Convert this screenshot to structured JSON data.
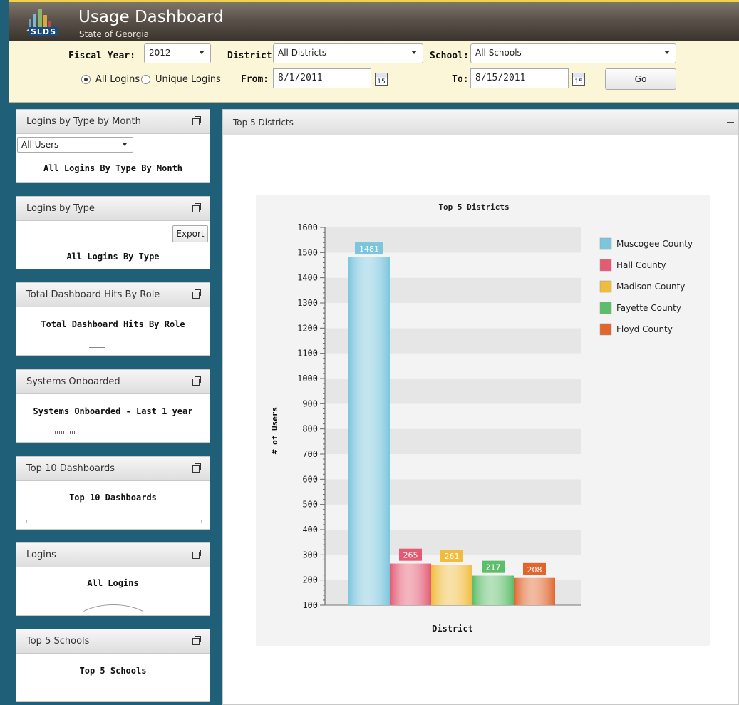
{
  "app": {
    "title": "Usage Dashboard",
    "subtitle": "State of Georgia",
    "logo_text": "SLDS"
  },
  "filters": {
    "fiscal_year_label": "Fiscal Year:",
    "fiscal_year_value": "2012",
    "district_label": "District:",
    "district_value": "All Districts",
    "school_label": "School:",
    "school_value": "All Schools",
    "radio_all_label": "All Logins",
    "radio_unique_label": "Unique Logins",
    "selected_radio": "All Logins",
    "from_label": "From:",
    "from_value": "8/1/2011",
    "to_label": "To:",
    "to_value": "8/15/2011",
    "calendar_day": "15",
    "go_label": "Go"
  },
  "widgets": [
    {
      "title": "Logins by Type by Month",
      "body_title": "All Logins By Type By Month",
      "dropdown": "All Users"
    },
    {
      "title": "Logins by Type",
      "body_title": "All Logins By Type",
      "button": "Export"
    },
    {
      "title": "Total Dashboard Hits By Role",
      "body_title": "Total Dashboard Hits By Role"
    },
    {
      "title": "Systems Onboarded",
      "body_title": "Systems Onboarded - Last 1 year"
    },
    {
      "title": "Top 10 Dashboards",
      "body_title": "Top 10 Dashboards"
    },
    {
      "title": "Logins",
      "body_title": "All Logins"
    },
    {
      "title": "Top 5 Schools",
      "body_title": "Top 5 Schools"
    }
  ],
  "main_panel": {
    "title": "Top 5 Districts"
  },
  "colors": {
    "accent_yellow": "#f0d24a",
    "sidebar_bg": "#1f5f77",
    "filter_bg": "#fbf6d8"
  },
  "chart_data": {
    "type": "bar",
    "title": "Top 5 Districts",
    "xlabel": "District",
    "ylabel": "# of Users",
    "ylim": [
      100,
      1600
    ],
    "yticks": [
      100,
      200,
      300,
      400,
      500,
      600,
      700,
      800,
      900,
      1000,
      1100,
      1200,
      1300,
      1400,
      1500,
      1600
    ],
    "grid": true,
    "legend_position": "right",
    "series": [
      {
        "name": "Muscogee County",
        "value": 1481,
        "color": "#7cc6dd"
      },
      {
        "name": "Hall County",
        "value": 265,
        "color": "#e35a72"
      },
      {
        "name": "Madison County",
        "value": 261,
        "color": "#f0bc3c"
      },
      {
        "name": "Fayette County",
        "value": 217,
        "color": "#5cbd6a"
      },
      {
        "name": "Floyd County",
        "value": 208,
        "color": "#e0662e"
      }
    ]
  }
}
